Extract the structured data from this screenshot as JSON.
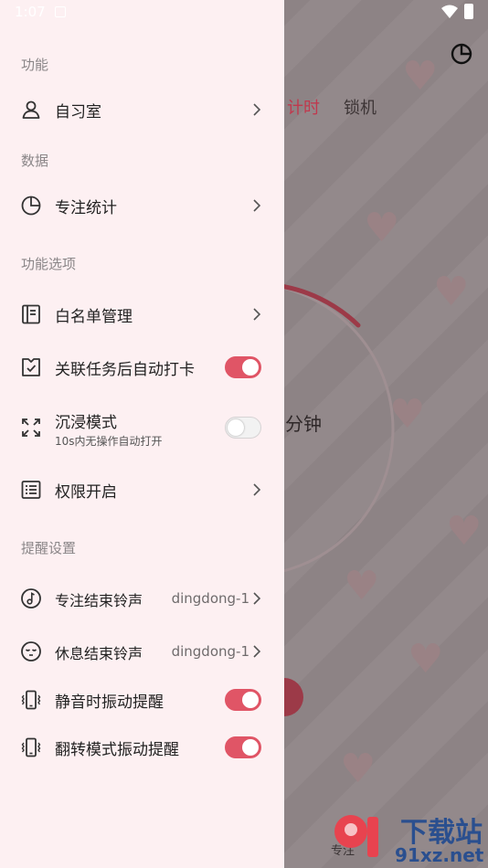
{
  "status_bar": {
    "time": "1:07"
  },
  "background": {
    "tab_timer": "计时",
    "tab_lock": "锁机",
    "minutes_label": "分钟",
    "focus_label": "专注",
    "watermark_top": "下载站",
    "watermark_bottom": "91xz.net"
  },
  "drawer": {
    "sections": {
      "features": "功能",
      "data": "数据",
      "feature_options": "功能选项",
      "reminders": "提醒设置"
    },
    "items": {
      "study_room": {
        "label": "自习室",
        "icon": "person-icon"
      },
      "focus_stats": {
        "label": "专注统计",
        "icon": "pie-chart-icon"
      },
      "whitelist": {
        "label": "白名单管理",
        "icon": "notebook-icon"
      },
      "auto_checkin": {
        "label": "关联任务后自动打卡",
        "icon": "calendar-check-icon",
        "enabled": true
      },
      "immersive": {
        "label": "沉浸模式",
        "sublabel": "10s内无操作自动打开",
        "icon": "expand-icon",
        "enabled": false
      },
      "permissions": {
        "label": "权限开启",
        "icon": "checklist-icon"
      },
      "focus_end_sound": {
        "label": "专注结束铃声",
        "value": "dingdong-1",
        "icon": "music-note-icon"
      },
      "rest_end_sound": {
        "label": "休息结束铃声",
        "value": "dingdong-1",
        "icon": "sleepy-face-icon"
      },
      "silent_vibrate": {
        "label": "静音时振动提醒",
        "icon": "vibrate-icon",
        "enabled": true
      },
      "flip_vibrate": {
        "label": "翻转模式振动提醒",
        "icon": "vibrate-icon",
        "enabled": true
      }
    }
  },
  "colors": {
    "accent": "#e05566",
    "drawer_bg": "#fdf0f2",
    "timer_red": "#c0394e"
  }
}
